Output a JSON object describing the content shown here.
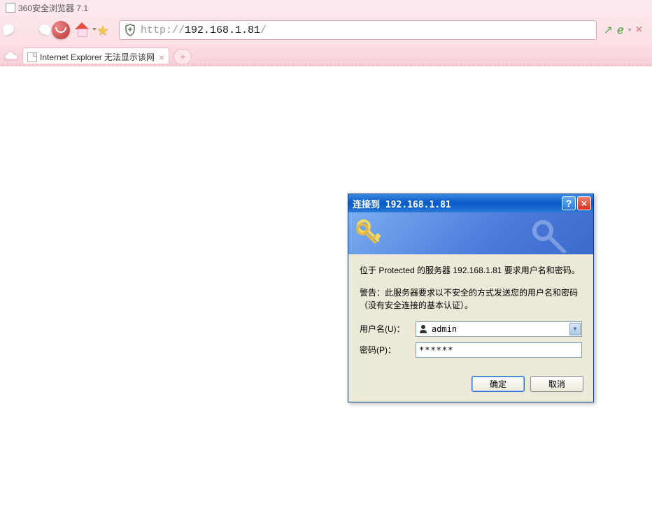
{
  "browser": {
    "title": "360安全浏览器 7.1",
    "url_prefix": "http://",
    "url_main": "192.168.1.81",
    "url_suffix": "/",
    "tab_title": "Internet Explorer 无法显示该网",
    "new_tab": "+"
  },
  "dialog": {
    "title_prefix": "连接到",
    "title_ip": "192.168.1.81",
    "banner_text": "",
    "message1": "位于 Protected 的服务器 192.168.1.81 要求用户名和密码。",
    "message2": "警告：此服务器要求以不安全的方式发送您的用户名和密码（没有安全连接的基本认证）。",
    "username_label": "用户名(U)：",
    "password_label": "密码(P)：",
    "username_value": "admin",
    "password_value": "******",
    "ok_button": "确定",
    "cancel_button": "取消"
  }
}
